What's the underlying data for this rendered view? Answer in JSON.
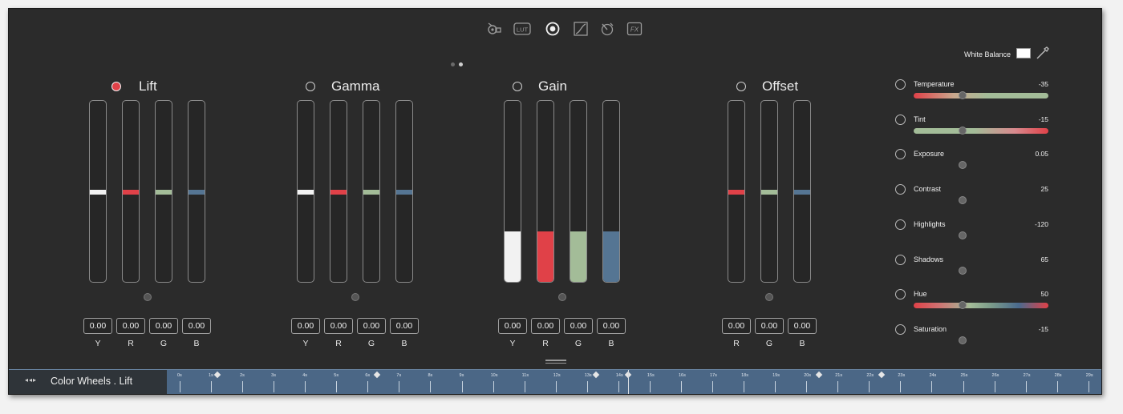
{
  "toolbar": {
    "icons": [
      "camera-icon",
      "lut-icon",
      "color-wheels-icon",
      "curves-icon",
      "secondary-icon",
      "fx-icon"
    ],
    "lut_text": "LUT",
    "fx_text": "FX",
    "active": "color-wheels-icon"
  },
  "pager": {
    "pages": 2,
    "active": 2
  },
  "groups": [
    {
      "title": "Lift",
      "selected": true,
      "channels": [
        {
          "label": "Y",
          "value": "0.00"
        },
        {
          "label": "R",
          "value": "0.00"
        },
        {
          "label": "G",
          "value": "0.00"
        },
        {
          "label": "B",
          "value": "0.00"
        }
      ]
    },
    {
      "title": "Gamma",
      "selected": false,
      "channels": [
        {
          "label": "Y",
          "value": "0.00"
        },
        {
          "label": "R",
          "value": "0.00"
        },
        {
          "label": "G",
          "value": "0.00"
        },
        {
          "label": "B",
          "value": "0.00"
        }
      ]
    },
    {
      "title": "Gain",
      "selected": false,
      "channels": [
        {
          "label": "Y",
          "value": "0.00"
        },
        {
          "label": "R",
          "value": "0.00"
        },
        {
          "label": "G",
          "value": "0.00"
        },
        {
          "label": "B",
          "value": "0.00"
        }
      ]
    },
    {
      "title": "Offset",
      "selected": false,
      "channels": [
        {
          "label": "R",
          "value": "0.00"
        },
        {
          "label": "G",
          "value": "0.00"
        },
        {
          "label": "B",
          "value": "0.00"
        }
      ]
    }
  ],
  "channel_colors": {
    "Y": "#f2f2f2",
    "R": "#e04148",
    "G": "#a3bc98",
    "B": "#557593"
  },
  "right_panel": {
    "white_balance_label": "White Balance",
    "white_balance_color": "#ffffff",
    "adjustments": [
      {
        "label": "Temperature",
        "value": "-35",
        "has_gradient": true
      },
      {
        "label": "Tint",
        "value": "-15",
        "has_gradient": true
      },
      {
        "label": "Exposure",
        "value": "0.05",
        "has_gradient": false
      },
      {
        "label": "Contrast",
        "value": "25",
        "has_gradient": false
      },
      {
        "label": "Highlights",
        "value": "-120",
        "has_gradient": false
      },
      {
        "label": "Shadows",
        "value": "65",
        "has_gradient": false
      },
      {
        "label": "Hue",
        "value": "50",
        "has_gradient": true
      },
      {
        "label": "Saturation",
        "value": "-15",
        "has_gradient": false
      }
    ]
  },
  "timeline": {
    "title": "Color Wheels . Lift",
    "nav_arrows": "◂◂▸",
    "tick_labels": [
      "0s",
      "1s",
      "2s",
      "3s",
      "4s",
      "5s",
      "6s",
      "7s",
      "8s",
      "9s",
      "10s",
      "11s",
      "12s",
      "13s",
      "14s",
      "15s",
      "16s",
      "17s",
      "18s",
      "19s",
      "20s",
      "21s",
      "22s",
      "23s",
      "24s",
      "25s",
      "26s",
      "27s",
      "28s",
      "29s"
    ],
    "keyframes_seconds": [
      1.2,
      6.3,
      13.3,
      14.3,
      20.4,
      22.4
    ],
    "playhead_seconds": 14.3
  }
}
